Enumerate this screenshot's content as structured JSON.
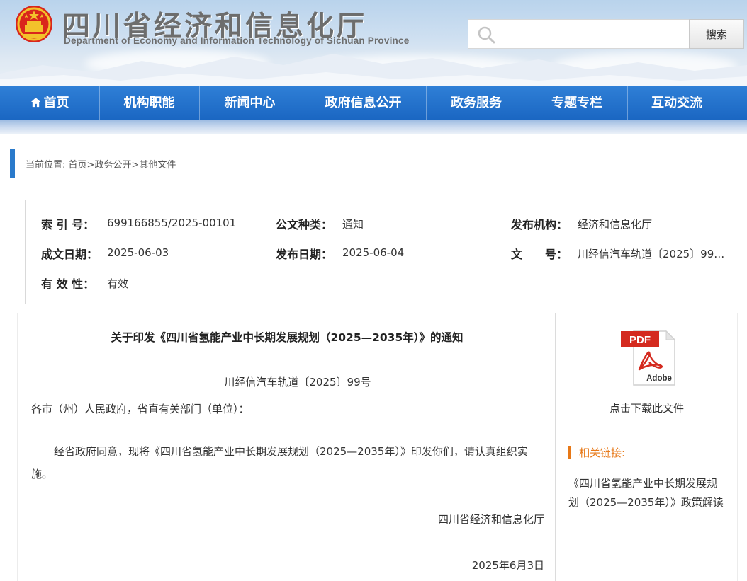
{
  "header": {
    "title": "四川省经济和信息化厅",
    "subtitle": "Department of Economy and Information Technology of Sichuan Province",
    "search_placeholder": "",
    "search_button": "搜索",
    "emblem_icon": "national-emblem-icon",
    "search_icon": "search-icon"
  },
  "nav": {
    "items": [
      {
        "label": "首页",
        "icon": "home-icon"
      },
      {
        "label": "机构职能"
      },
      {
        "label": "新闻中心"
      },
      {
        "label": "政府信息公开"
      },
      {
        "label": "政务服务"
      },
      {
        "label": "专题专栏"
      },
      {
        "label": "互动交流"
      }
    ]
  },
  "breadcrumb": {
    "prefix": "当前位置: ",
    "items": [
      "首页",
      "政务公开",
      "其他文件"
    ],
    "separator": ">"
  },
  "meta": {
    "index_label": "索 引 号：",
    "index_value": "699166855/2025-00101",
    "type_label": "公文种类：",
    "type_value": "通知",
    "publisher_label": "发布机构：",
    "publisher_value": "经济和信息化厅",
    "created_label": "成文日期：",
    "created_value": "2025-06-03",
    "published_label": "发布日期：",
    "published_value": "2025-06-04",
    "docno_label": "文　　号：",
    "docno_value": "川经信汽车轨道〔2025〕99…",
    "validity_label": "有 效 性：",
    "validity_value": "有效"
  },
  "document": {
    "title": "关于印发《四川省氢能产业中长期发展规划（2025—2035年）》的通知",
    "number": "川经信汽车轨道〔2025〕99号",
    "salutation": "各市（州）人民政府，省直有关部门（单位）：",
    "body": "经省政府同意，现将《四川省氢能产业中长期发展规划（2025—2035年）》印发你们，请认真组织实施。",
    "signature": "四川省经济和信息化厅",
    "date": "2025年6月3日"
  },
  "sidebar": {
    "pdf_icon": "pdf-adobe-icon",
    "pdf_label": "PDF",
    "pdf_brand": "Adobe",
    "download_label": "点击下载此文件",
    "related_title": "相关链接:",
    "related_links": [
      "《四川省氢能产业中长期发展规划（2025—2035年）》政策解读"
    ]
  },
  "colors": {
    "nav_blue": "#1f6ec8",
    "accent_orange": "#e77817",
    "breadcrumb_bar": "#2a7acb"
  }
}
